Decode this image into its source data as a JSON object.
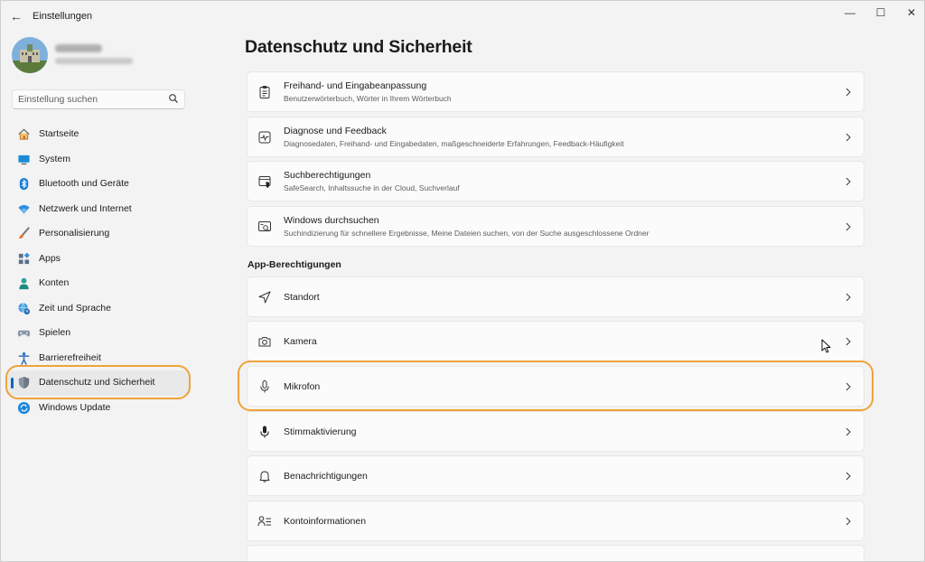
{
  "window": {
    "app_title": "Einstellungen",
    "back_label": "←",
    "minimize_label": "—",
    "maximize_label": "☐",
    "close_label": "✕"
  },
  "search": {
    "placeholder": "Einstellung suchen"
  },
  "sidebar": {
    "items": [
      {
        "label": "Startseite",
        "icon": "home-icon"
      },
      {
        "label": "System",
        "icon": "monitor-icon"
      },
      {
        "label": "Bluetooth und Geräte",
        "icon": "bluetooth-icon"
      },
      {
        "label": "Netzwerk und Internet",
        "icon": "wifi-icon"
      },
      {
        "label": "Personalisierung",
        "icon": "brush-icon"
      },
      {
        "label": "Apps",
        "icon": "apps-icon"
      },
      {
        "label": "Konten",
        "icon": "person-icon"
      },
      {
        "label": "Zeit und Sprache",
        "icon": "globe-clock-icon"
      },
      {
        "label": "Spielen",
        "icon": "gamepad-icon"
      },
      {
        "label": "Barrierefreiheit",
        "icon": "accessibility-icon"
      },
      {
        "label": "Datenschutz und Sicherheit",
        "icon": "shield-icon",
        "active": true
      },
      {
        "label": "Windows Update",
        "icon": "update-icon"
      }
    ]
  },
  "main": {
    "title": "Datenschutz und Sicherheit",
    "cards_top": [
      {
        "title": "Freihand- und Eingabeanpassung",
        "subtitle": "Benutzerwörterbuch, Wörter in Ihrem Wörterbuch",
        "icon": "clipboard-list-icon"
      },
      {
        "title": "Diagnose und Feedback",
        "subtitle": "Diagnosedaten, Freihand- und Eingabedaten, maßgeschneiderte Erfahrungen, Feedback-Häufigkeit",
        "icon": "diagnostic-pulse-icon"
      },
      {
        "title": "Suchberechtigungen",
        "subtitle": "SafeSearch, Inhaltssuche in der Cloud, Suchverlauf",
        "icon": "search-shield-icon"
      },
      {
        "title": "Windows durchsuchen",
        "subtitle": "Suchindizierung für schnellere Ergebnisse, Meine Dateien suchen, von der Suche ausgeschlossene Ordner",
        "icon": "window-search-icon"
      }
    ],
    "section_header": "App-Berechtigungen",
    "cards_permissions": [
      {
        "title": "Standort",
        "icon": "location-arrow-icon"
      },
      {
        "title": "Kamera",
        "icon": "camera-icon"
      },
      {
        "title": "Mikrofon",
        "icon": "microphone-icon"
      },
      {
        "title": "Stimmaktivierung",
        "icon": "voice-microphone-icon"
      },
      {
        "title": "Benachrichtigungen",
        "icon": "bell-icon"
      },
      {
        "title": "Kontoinformationen",
        "icon": "account-info-icon"
      }
    ]
  },
  "colors": {
    "accent": "#0067c0",
    "highlight": "#f0a23b",
    "background": "#f3f3f3",
    "card": "#fbfbfb"
  }
}
